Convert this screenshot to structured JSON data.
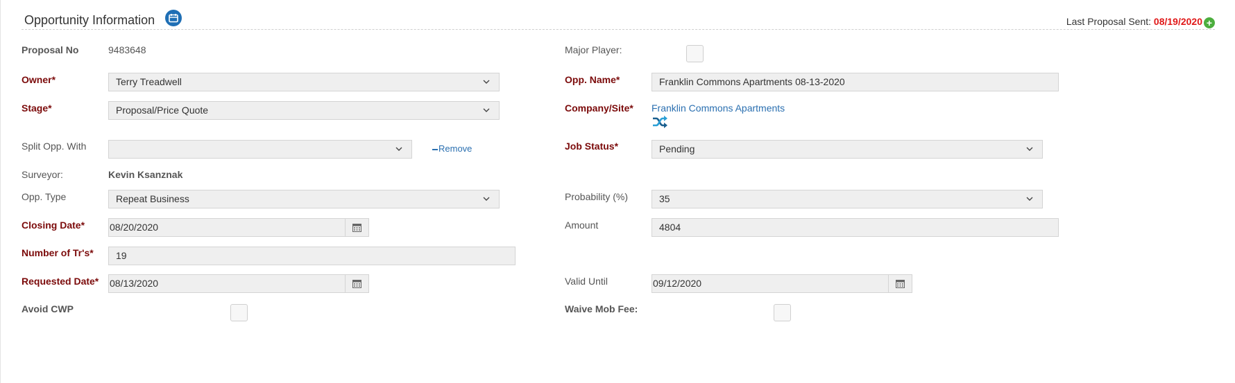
{
  "header": {
    "title": "Opportunity Information",
    "title_icon": "calendar-icon",
    "last_sent_label": "Last Proposal Sent:",
    "last_sent_date": "08/19/2020",
    "last_sent_color": "#e01818",
    "add_icon": "plus-circle-icon"
  },
  "left": {
    "proposal_no_label": "Proposal No",
    "proposal_no_value": "9483648",
    "owner_label": "Owner*",
    "owner_value": "Terry Treadwell",
    "stage_label": "Stage*",
    "stage_value": "Proposal/Price Quote",
    "split_label": "Split Opp. With",
    "split_value": "",
    "remove_label": "Remove",
    "surveyor_label": "Surveyor:",
    "surveyor_value": "Kevin Ksanznak",
    "opp_type_label": "Opp. Type",
    "opp_type_value": "Repeat Business",
    "closing_date_label": "Closing Date*",
    "closing_date_value": "08/20/2020",
    "num_trs_label": "Number of Tr's*",
    "num_trs_value": "19",
    "requested_date_label": "Requested Date*",
    "requested_date_value": "08/13/2020",
    "avoid_cwp_label": "Avoid CWP",
    "avoid_cwp_checked": false
  },
  "right": {
    "major_player_label": "Major Player:",
    "major_player_checked": false,
    "opp_name_label": "Opp. Name*",
    "opp_name_value": "Franklin Commons Apartments 08-13-2020",
    "company_label": "Company/Site*",
    "company_value": "Franklin Commons Apartments",
    "company_icon": "shuffle-icon",
    "job_status_label": "Job Status*",
    "job_status_value": "Pending",
    "probability_label": "Probability (%)",
    "probability_value": "35",
    "amount_label": "Amount",
    "amount_value": "4804",
    "valid_until_label": "Valid Until",
    "valid_until_value": "09/12/2020",
    "waive_mob_label": "Waive Mob Fee:",
    "waive_mob_checked": false
  },
  "colors": {
    "required_label": "#7b0a0a",
    "link": "#2a6fb0",
    "field_bg": "#efefef",
    "icon_blue": "#1f6fb5",
    "add_green": "#4cae3e"
  }
}
